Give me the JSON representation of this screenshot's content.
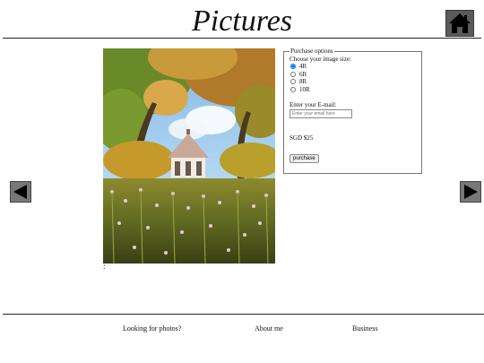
{
  "header": {
    "title": "Pictures",
    "home_icon": "house-icon"
  },
  "gallery": {
    "prev_icon": "left-arrow-icon",
    "next_icon": "right-arrow-icon",
    "caption": ":"
  },
  "purchase": {
    "legend": "Purchase options",
    "size_prompt": "Choose your image size:",
    "sizes": [
      "4R",
      "6R",
      "8R",
      "10R"
    ],
    "selected_size": "4R",
    "email_label": "Enter your E-mail:",
    "email_placeholder": "Enter your email here",
    "price": "SGD $25",
    "button_label": "purchase"
  },
  "footer": {
    "links": [
      "Looking for photos?",
      "About me",
      "Business"
    ]
  },
  "colors": {
    "text": "#111111",
    "rule": "#222222",
    "icon_bg": "#5a5a5a"
  }
}
